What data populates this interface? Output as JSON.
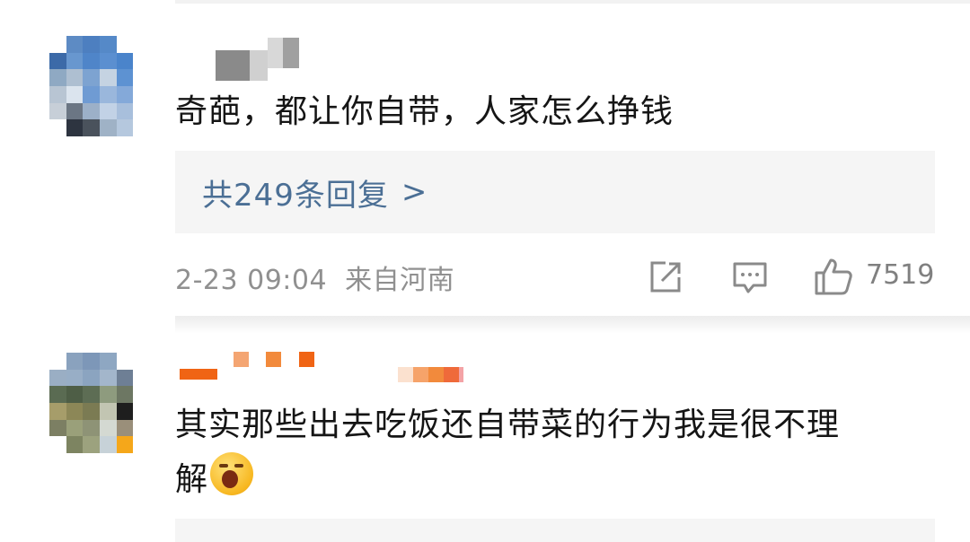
{
  "comments": [
    {
      "text": "奇葩，都让你自带，人家怎么挣钱",
      "replies_label": "共249条回复",
      "replies_arrow": ">",
      "timestamp": "2-23 09:04",
      "location": "来自河南",
      "like_count": "7519",
      "icons": [
        "share-icon",
        "comment-icon",
        "like-icon"
      ]
    },
    {
      "text_line1": "其实那些出去吃饭还自带菜的行为我是很不理",
      "text_line2": "解"
    }
  ],
  "colors": {
    "link": "#4b6f95",
    "meta": "#909090",
    "reply_bg": "#f5f5f5"
  }
}
